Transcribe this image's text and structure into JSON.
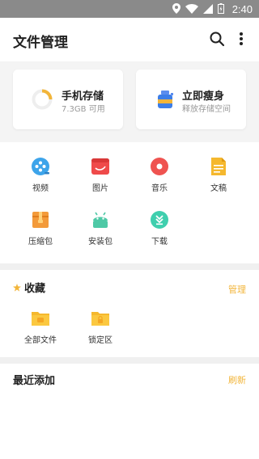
{
  "status_bar": {
    "time": "2:40",
    "icons": [
      "location-icon",
      "wifi-icon",
      "signal-icon",
      "battery-icon"
    ]
  },
  "header": {
    "title": "文件管理",
    "search_icon": "search-icon",
    "more_icon": "more-vert-icon"
  },
  "storage": {
    "phone_title": "手机存储",
    "phone_sub": "7.3GB 可用",
    "clean_title": "立即瘦身",
    "clean_sub": "释放存储空间"
  },
  "categories": [
    {
      "label": "视频",
      "icon": "video-icon"
    },
    {
      "label": "图片",
      "icon": "image-icon"
    },
    {
      "label": "音乐",
      "icon": "music-icon"
    },
    {
      "label": "文稿",
      "icon": "document-icon"
    },
    {
      "label": "压缩包",
      "icon": "archive-icon"
    },
    {
      "label": "安装包",
      "icon": "android-icon"
    },
    {
      "label": "下载",
      "icon": "download-icon"
    }
  ],
  "favorites": {
    "title": "收藏",
    "manage": "管理",
    "items": [
      {
        "label": "全部文件",
        "icon": "folder-icon"
      },
      {
        "label": "锁定区",
        "icon": "locked-folder-icon"
      }
    ]
  },
  "recent": {
    "title": "最近添加",
    "refresh": "刷新"
  },
  "colors": {
    "accent": "#f2b53a",
    "status_bar": "#8a8a8a",
    "video": "#3da4ea",
    "image": "#ef4a4a",
    "music": "#ef5350",
    "document": "#f5b82e",
    "archive": "#f39a3a",
    "android": "#4ec9a6",
    "download": "#3fcfae"
  }
}
